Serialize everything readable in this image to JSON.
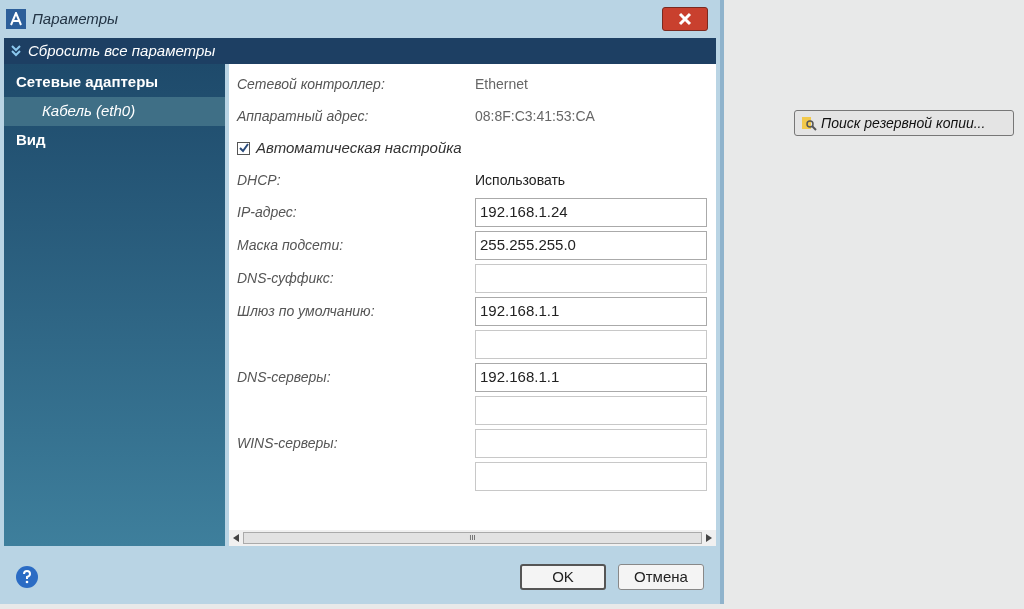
{
  "window": {
    "title": "Параметры"
  },
  "reset_bar": {
    "label": "Сбросить все параметры"
  },
  "sidebar": {
    "items": [
      {
        "label": "Сетевые адаптеры",
        "selected": false,
        "children": [
          {
            "label": "Кабель (eth0)",
            "selected": true
          }
        ]
      },
      {
        "label": "Вид",
        "selected": false
      }
    ]
  },
  "form": {
    "rows": [
      {
        "kind": "text",
        "label": "Сетевой контроллер:",
        "value": "Ethernet"
      },
      {
        "kind": "text",
        "label": "Аппаратный адрес:",
        "value": "08:8F:C3:41:53:CA"
      },
      {
        "kind": "checkbox",
        "label": "Автоматическая настройка",
        "checked": true
      },
      {
        "kind": "text",
        "label": "DHCP:",
        "value": "Использовать"
      },
      {
        "kind": "input",
        "label": "IP-адрес:",
        "inputs": [
          {
            "value": "192.168.1.24"
          }
        ]
      },
      {
        "kind": "input",
        "label": "Маска подсети:",
        "inputs": [
          {
            "value": "255.255.255.0"
          }
        ]
      },
      {
        "kind": "input",
        "label": "DNS-суффикс:",
        "inputs": [
          {
            "filled": false
          }
        ]
      },
      {
        "kind": "input",
        "label": "Шлюз по умолчанию:",
        "inputs": [
          {
            "value": "192.168.1.1"
          },
          {
            "filled": false
          }
        ]
      },
      {
        "kind": "input",
        "label": "DNS-серверы:",
        "inputs": [
          {
            "value": "192.168.1.1"
          },
          {
            "filled": false
          }
        ]
      },
      {
        "kind": "input",
        "label": "WINS-серверы:",
        "inputs": [
          {
            "filled": false
          },
          {
            "filled": false
          }
        ]
      }
    ]
  },
  "scrollbar": {
    "grip": "III"
  },
  "buttons": [
    {
      "label": "OK",
      "default": true
    },
    {
      "label": "Отмена",
      "default": false
    }
  ],
  "side_button": {
    "label": "Поиск резервной копии..."
  }
}
